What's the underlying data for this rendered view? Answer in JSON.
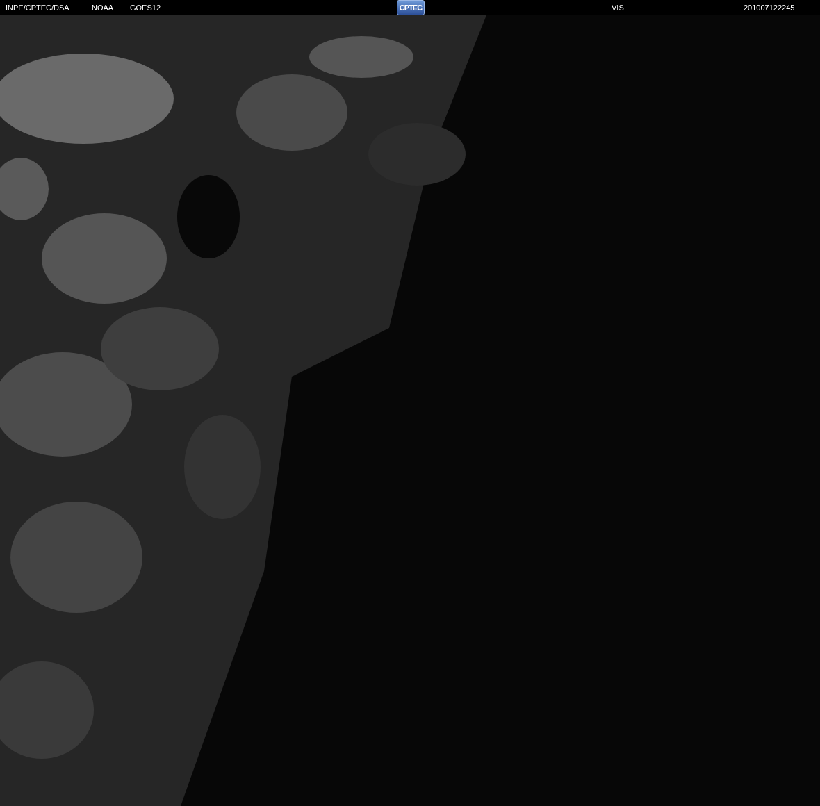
{
  "header": {
    "source": "INPE/CPTEC/DSA",
    "agency": "NOAA",
    "satellite": "GOES12",
    "logo": "CPTEC",
    "channel": "VIS",
    "timestamp": "201007122245"
  }
}
